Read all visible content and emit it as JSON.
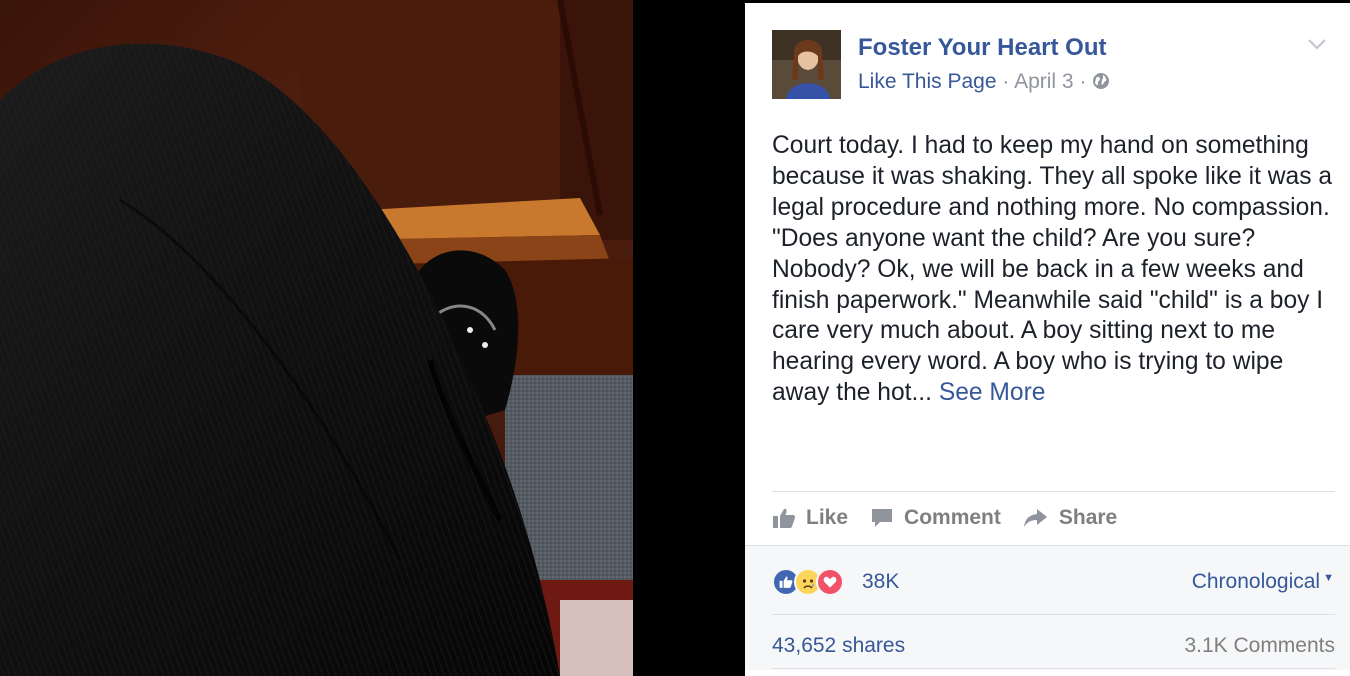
{
  "post": {
    "page_name": "Foster Your Heart Out",
    "like_page_label": "Like This Page",
    "separator": "·",
    "date": "April 3",
    "privacy_icon": "globe-icon",
    "options_icon": "chevron-down-icon",
    "text": "Court today. I had to keep my hand on something because it was shaking. They all spoke like it was a legal procedure and nothing more. No compassion. \"Does anyone want the child? Are you sure? Nobody? Ok, we will be back in a few weeks and finish paperwork.\" Meanwhile said \"child\" is a boy I care very much about. A boy sitting next to me hearing every word. A boy who is trying to wipe away the hot...",
    "see_more_label": "See More"
  },
  "actions": {
    "like_label": "Like",
    "comment_label": "Comment",
    "share_label": "Share"
  },
  "engagement": {
    "reaction_icons": [
      "like-reaction-icon",
      "sad-reaction-icon",
      "love-reaction-icon"
    ],
    "reaction_count": "38K",
    "sort_label": "Chronological",
    "shares_label": "43,652 shares",
    "comments_label": "3.1K Comments"
  },
  "colors": {
    "link_blue": "#365899",
    "like_blue": "#4267b2",
    "love_red": "#f25268",
    "sad_yellow": "#fcd55b"
  }
}
